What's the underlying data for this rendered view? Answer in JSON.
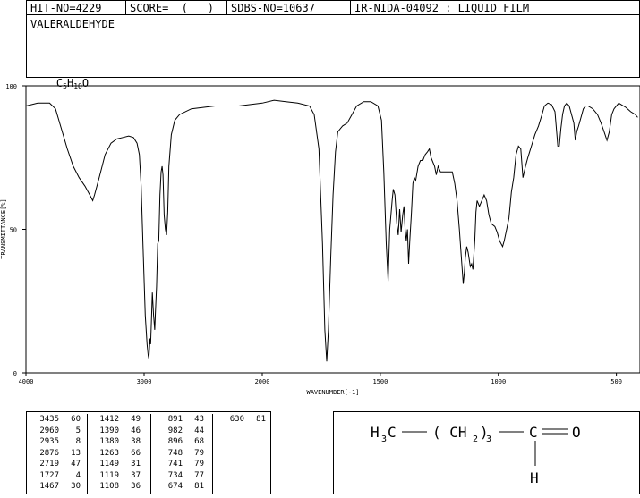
{
  "header": {
    "hit_no": "HIT-NO=4229",
    "score": "SCORE=  (   )",
    "sdbs_no": "SDBS-NO=10637",
    "ir_no": "IR-NIDA-04092 : LIQUID FILM"
  },
  "compound": {
    "name": "VALERALDEHYDE",
    "formula_parts": [
      "C",
      "5",
      "H",
      "10",
      "O"
    ]
  },
  "chart_data": {
    "type": "line",
    "xlabel": "WAVENUMBER[-1]",
    "ylabel": "TRANSMITTANCE[%]",
    "xlim": [
      4000,
      400
    ],
    "ylim": [
      0,
      100
    ],
    "x_ticks": [
      4000,
      3000,
      2000,
      1500,
      1000,
      500
    ],
    "y_ticks": [
      0,
      50,
      100
    ],
    "grid": false,
    "series": [
      {
        "color": "#000000",
        "points": [
          [
            4000,
            93
          ],
          [
            3900,
            94
          ],
          [
            3800,
            94
          ],
          [
            3750,
            92
          ],
          [
            3700,
            85
          ],
          [
            3650,
            78
          ],
          [
            3600,
            72
          ],
          [
            3550,
            68
          ],
          [
            3500,
            65
          ],
          [
            3460,
            62
          ],
          [
            3435,
            60
          ],
          [
            3420,
            62
          ],
          [
            3380,
            68
          ],
          [
            3330,
            76
          ],
          [
            3280,
            80
          ],
          [
            3230,
            81.5
          ],
          [
            3180,
            82
          ],
          [
            3130,
            82.5
          ],
          [
            3090,
            82
          ],
          [
            3060,
            80
          ],
          [
            3040,
            76
          ],
          [
            3025,
            65
          ],
          [
            3010,
            45
          ],
          [
            2990,
            20
          ],
          [
            2975,
            10
          ],
          [
            2965,
            6
          ],
          [
            2960,
            5
          ],
          [
            2955,
            8
          ],
          [
            2950,
            12
          ],
          [
            2945,
            10
          ],
          [
            2935,
            22
          ],
          [
            2930,
            28
          ],
          [
            2920,
            20
          ],
          [
            2910,
            15
          ],
          [
            2905,
            20
          ],
          [
            2895,
            30
          ],
          [
            2885,
            45
          ],
          [
            2876,
            46
          ],
          [
            2866,
            62
          ],
          [
            2856,
            70
          ],
          [
            2848,
            72
          ],
          [
            2840,
            69
          ],
          [
            2830,
            55
          ],
          [
            2820,
            50
          ],
          [
            2810,
            48
          ],
          [
            2800,
            56
          ],
          [
            2790,
            72
          ],
          [
            2770,
            83
          ],
          [
            2740,
            88
          ],
          [
            2700,
            90
          ],
          [
            2600,
            92
          ],
          [
            2400,
            93
          ],
          [
            2200,
            93
          ],
          [
            2000,
            94
          ],
          [
            1950,
            95
          ],
          [
            1900,
            94.5
          ],
          [
            1850,
            94
          ],
          [
            1800,
            93
          ],
          [
            1780,
            90
          ],
          [
            1760,
            78
          ],
          [
            1745,
            45
          ],
          [
            1735,
            15
          ],
          [
            1727,
            4
          ],
          [
            1720,
            15
          ],
          [
            1710,
            40
          ],
          [
            1700,
            62
          ],
          [
            1690,
            77
          ],
          [
            1680,
            84
          ],
          [
            1660,
            86
          ],
          [
            1640,
            87
          ],
          [
            1620,
            90
          ],
          [
            1600,
            93
          ],
          [
            1570,
            94.5
          ],
          [
            1540,
            94.5
          ],
          [
            1510,
            93
          ],
          [
            1495,
            88
          ],
          [
            1485,
            70
          ],
          [
            1475,
            45
          ],
          [
            1467,
            32
          ],
          [
            1460,
            50
          ],
          [
            1450,
            60
          ],
          [
            1445,
            64
          ],
          [
            1438,
            62
          ],
          [
            1430,
            52
          ],
          [
            1424,
            48
          ],
          [
            1418,
            57
          ],
          [
            1412,
            49
          ],
          [
            1405,
            55
          ],
          [
            1400,
            58
          ],
          [
            1395,
            50
          ],
          [
            1390,
            46
          ],
          [
            1385,
            50
          ],
          [
            1380,
            38
          ],
          [
            1375,
            46
          ],
          [
            1368,
            56
          ],
          [
            1362,
            66
          ],
          [
            1356,
            68
          ],
          [
            1350,
            67
          ],
          [
            1340,
            72
          ],
          [
            1330,
            74
          ],
          [
            1320,
            74
          ],
          [
            1310,
            76
          ],
          [
            1300,
            77
          ],
          [
            1292,
            78
          ],
          [
            1285,
            75
          ],
          [
            1270,
            72
          ],
          [
            1263,
            69
          ],
          [
            1255,
            72
          ],
          [
            1245,
            70
          ],
          [
            1230,
            70
          ],
          [
            1210,
            70
          ],
          [
            1195,
            70
          ],
          [
            1185,
            66
          ],
          [
            1175,
            60
          ],
          [
            1165,
            50
          ],
          [
            1155,
            38
          ],
          [
            1149,
            31
          ],
          [
            1144,
            35
          ],
          [
            1140,
            40
          ],
          [
            1134,
            44
          ],
          [
            1128,
            42
          ],
          [
            1119,
            37
          ],
          [
            1113,
            38
          ],
          [
            1108,
            36
          ],
          [
            1100,
            46
          ],
          [
            1095,
            56
          ],
          [
            1090,
            60
          ],
          [
            1080,
            58
          ],
          [
            1070,
            60
          ],
          [
            1060,
            62
          ],
          [
            1050,
            60
          ],
          [
            1040,
            55
          ],
          [
            1030,
            52
          ],
          [
            1015,
            51
          ],
          [
            1005,
            49
          ],
          [
            995,
            46
          ],
          [
            982,
            44
          ],
          [
            975,
            46
          ],
          [
            965,
            50
          ],
          [
            955,
            54
          ],
          [
            945,
            63
          ],
          [
            935,
            68
          ],
          [
            925,
            76
          ],
          [
            915,
            79
          ],
          [
            905,
            78
          ],
          [
            896,
            68
          ],
          [
            885,
            72
          ],
          [
            875,
            75
          ],
          [
            860,
            79
          ],
          [
            845,
            83
          ],
          [
            830,
            86
          ],
          [
            815,
            90
          ],
          [
            805,
            93
          ],
          [
            790,
            94
          ],
          [
            775,
            93.5
          ],
          [
            760,
            91
          ],
          [
            748,
            79
          ],
          [
            742,
            79
          ],
          [
            735,
            85
          ],
          [
            728,
            90
          ],
          [
            720,
            93
          ],
          [
            710,
            94
          ],
          [
            700,
            93
          ],
          [
            690,
            90
          ],
          [
            680,
            87
          ],
          [
            674,
            81
          ],
          [
            668,
            84
          ],
          [
            660,
            86
          ],
          [
            650,
            89
          ],
          [
            640,
            92
          ],
          [
            630,
            93
          ],
          [
            620,
            93
          ],
          [
            600,
            92
          ],
          [
            580,
            90
          ],
          [
            565,
            87
          ],
          [
            552,
            84
          ],
          [
            540,
            81
          ],
          [
            530,
            84
          ],
          [
            520,
            90
          ],
          [
            510,
            92
          ],
          [
            500,
            93
          ],
          [
            490,
            94
          ],
          [
            480,
            93.5
          ],
          [
            460,
            92.5
          ],
          [
            440,
            91
          ],
          [
            420,
            90
          ],
          [
            410,
            89
          ]
        ]
      }
    ]
  },
  "peak_table": {
    "columns": [
      [
        [
          "3435",
          "60"
        ],
        [
          "2960",
          "5"
        ],
        [
          "2935",
          "8"
        ],
        [
          "2876",
          "13"
        ],
        [
          "2719",
          "47"
        ],
        [
          "1727",
          "4"
        ],
        [
          "1467",
          "30"
        ]
      ],
      [
        [
          "1412",
          "49"
        ],
        [
          "1390",
          "46"
        ],
        [
          "1380",
          "38"
        ],
        [
          "1263",
          "66"
        ],
        [
          "1149",
          "31"
        ],
        [
          "1119",
          "37"
        ],
        [
          "1108",
          "36"
        ]
      ],
      [
        [
          "891",
          "43"
        ],
        [
          "982",
          "44"
        ],
        [
          "896",
          "68"
        ],
        [
          "748",
          "79"
        ],
        [
          "741",
          "79"
        ],
        [
          "734",
          "77"
        ],
        [
          "674",
          "81"
        ]
      ],
      [
        [
          "630",
          "81"
        ]
      ]
    ]
  },
  "structure": {
    "h3c": "H",
    "h3c_sub": "3",
    "h3c_tail": "C",
    "chain": "( CH",
    "chain_sub": "2",
    "chain_close": ")",
    "chain_n": "3",
    "carbon": "C",
    "oxygen": "O",
    "hydrogen": "H"
  }
}
